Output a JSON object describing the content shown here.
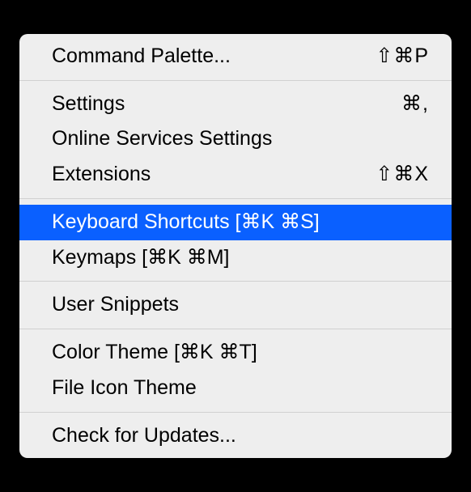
{
  "menu": {
    "groups": [
      [
        {
          "id": "command-palette",
          "label": "Command Palette...",
          "shortcut": "⇧⌘P",
          "selected": false
        }
      ],
      [
        {
          "id": "settings",
          "label": "Settings",
          "shortcut": "⌘,",
          "selected": false
        },
        {
          "id": "online-services-settings",
          "label": "Online Services Settings",
          "shortcut": "",
          "selected": false
        },
        {
          "id": "extensions",
          "label": "Extensions",
          "shortcut": "⇧⌘X",
          "selected": false
        }
      ],
      [
        {
          "id": "keyboard-shortcuts",
          "label": "Keyboard Shortcuts [⌘K ⌘S]",
          "shortcut": "",
          "selected": true
        },
        {
          "id": "keymaps",
          "label": "Keymaps [⌘K ⌘M]",
          "shortcut": "",
          "selected": false
        }
      ],
      [
        {
          "id": "user-snippets",
          "label": "User Snippets",
          "shortcut": "",
          "selected": false
        }
      ],
      [
        {
          "id": "color-theme",
          "label": "Color Theme [⌘K ⌘T]",
          "shortcut": "",
          "selected": false
        },
        {
          "id": "file-icon-theme",
          "label": "File Icon Theme",
          "shortcut": "",
          "selected": false
        }
      ],
      [
        {
          "id": "check-for-updates",
          "label": "Check for Updates...",
          "shortcut": "",
          "selected": false
        }
      ]
    ]
  }
}
